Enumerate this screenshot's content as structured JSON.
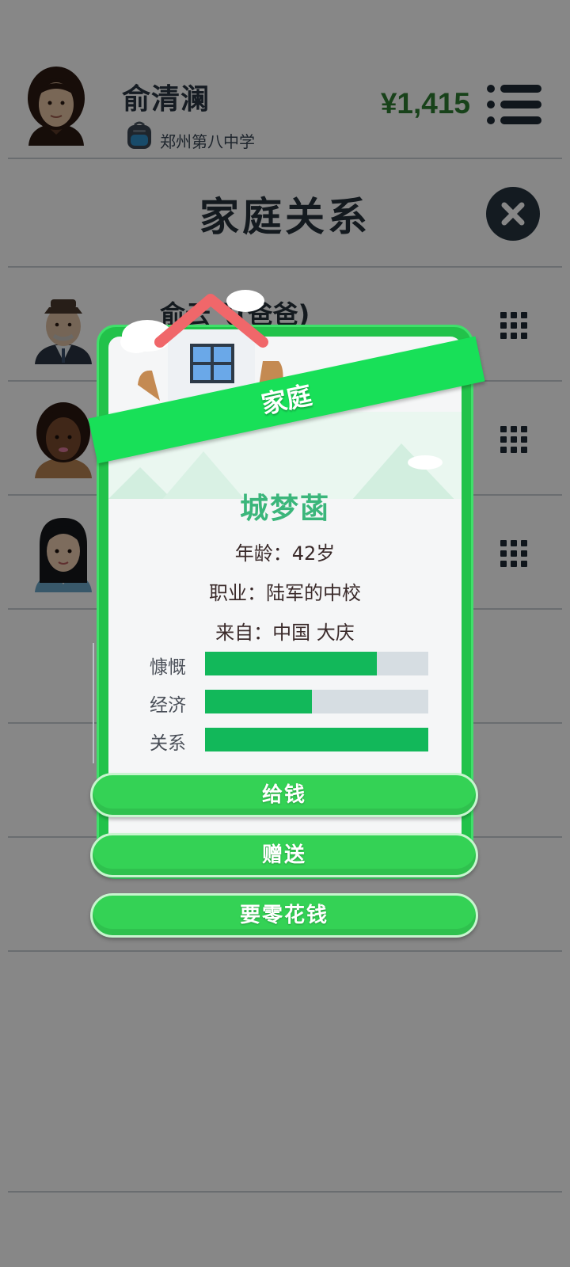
{
  "header": {
    "player_name": "俞清澜",
    "school": "郑州第八中学",
    "money": "¥1,415"
  },
  "page": {
    "title": "家庭关系"
  },
  "members": [
    {
      "name": "俞云飞(爸爸)"
    },
    {
      "name": ""
    },
    {
      "name": ""
    }
  ],
  "modal": {
    "ribbon": "家庭",
    "name": "城梦菡",
    "age_line": "年龄：42岁",
    "job_line": "职业：陆军的中校",
    "from_line": "来自：中国 大庆",
    "stats": [
      {
        "label": "慷慨",
        "fraction": 0.77
      },
      {
        "label": "经济",
        "fraction": 0.48
      },
      {
        "label": "关系",
        "fraction": 1.0
      }
    ],
    "buttons": {
      "give_money": "给钱",
      "gift": "赠送",
      "ask_allowance": "要零花钱"
    }
  },
  "colors": {
    "money": "#2e7d32",
    "accent_green": "#22c24a",
    "stat_fill": "#12b85a",
    "name_teal": "#3bb67b"
  },
  "icons": [
    "school-bag-icon",
    "menu-list-icon",
    "close-icon",
    "grid-icon",
    "house-icon"
  ]
}
